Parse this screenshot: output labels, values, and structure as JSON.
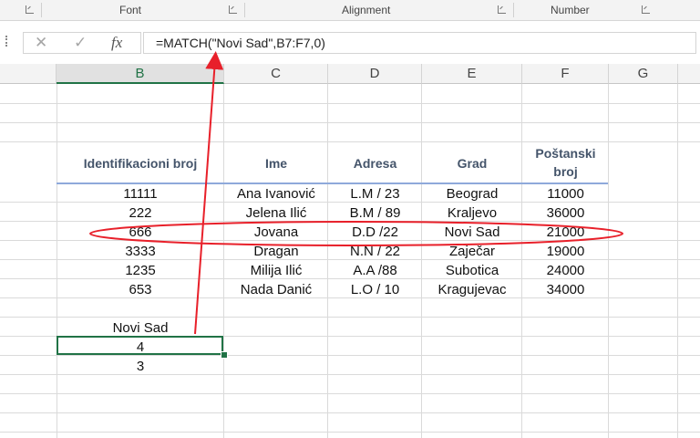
{
  "ribbon": {
    "groups": [
      {
        "label": "Font"
      },
      {
        "label": "Alignment"
      },
      {
        "label": "Number"
      }
    ]
  },
  "formula_bar": {
    "cancel_glyph": "✕",
    "enter_glyph": "✓",
    "fx_label": "fx",
    "formula": "=MATCH(\"Novi Sad\",B7:F7,0)"
  },
  "columns": [
    "B",
    "C",
    "D",
    "E",
    "F",
    "G"
  ],
  "selected_column": "B",
  "table": {
    "headers": {
      "id": "Identifikacioni broj",
      "name": "Ime",
      "address": "Adresa",
      "city": "Grad",
      "zip_line1": "Poštanski",
      "zip_line2": "broj"
    },
    "rows": [
      {
        "id": "11111",
        "name": "Ana Ivanović",
        "address": "L.M / 23",
        "city": "Beograd",
        "zip": "11000"
      },
      {
        "id": "222",
        "name": "Jelena Ilić",
        "address": "B.M / 89",
        "city": "Kraljevo",
        "zip": "36000"
      },
      {
        "id": "666",
        "name": "Jovana",
        "address": "D.D /22",
        "city": "Novi Sad",
        "zip": "21000"
      },
      {
        "id": "3333",
        "name": "Dragan",
        "address": "N.N / 22",
        "city": "Zaječar",
        "zip": "19000"
      },
      {
        "id": "1235",
        "name": "Milija Ilić",
        "address": "A.A /88",
        "city": "Subotica",
        "zip": "24000"
      },
      {
        "id": "653",
        "name": "Nada Danić",
        "address": "L.O / 10",
        "city": "Kragujevac",
        "zip": "34000"
      }
    ]
  },
  "lookup": {
    "label": "Novi Sad",
    "result": "4",
    "extra": "3"
  },
  "annotation": {
    "color": "#e8202a"
  }
}
